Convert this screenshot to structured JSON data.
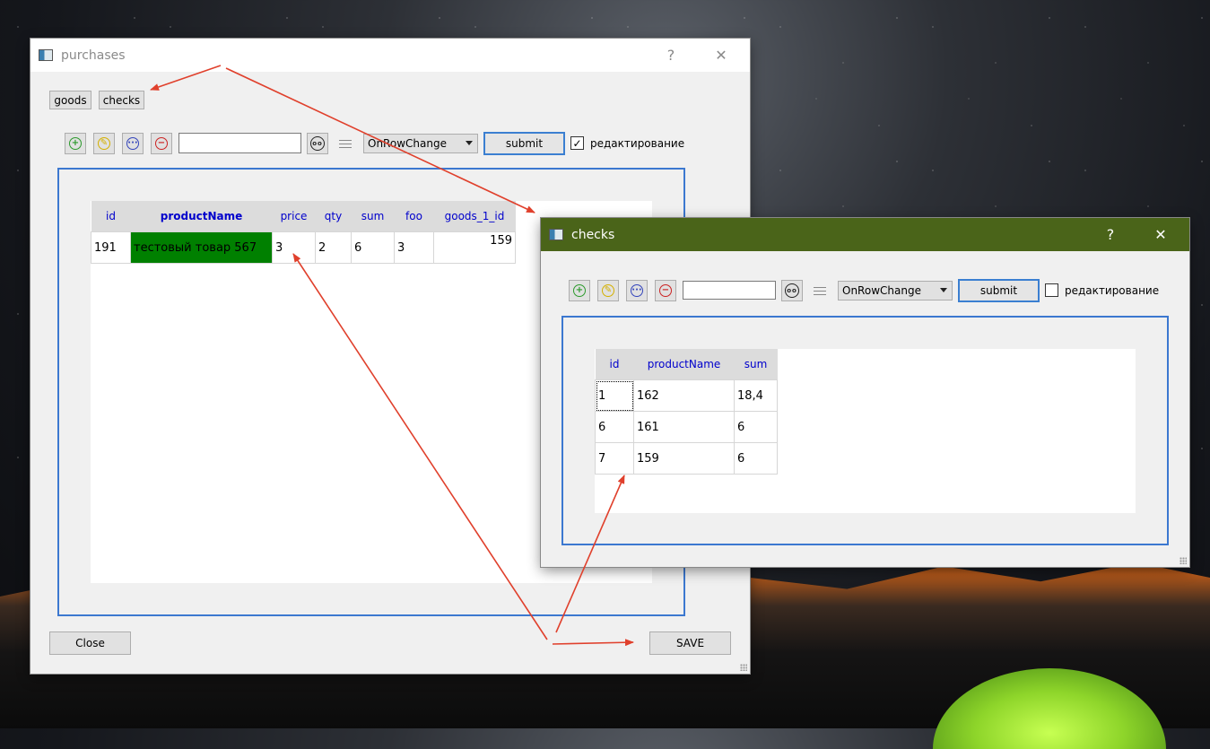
{
  "purchases_window": {
    "title": "purchases",
    "help": "?",
    "close": "✕",
    "tabs": [
      "goods",
      "checks"
    ],
    "toolbar": {
      "search_value": "",
      "mode_select": "OnRowChange",
      "submit_label": "submit",
      "edit_checkbox_label": "редактирование",
      "edit_checked": true
    },
    "table": {
      "headers": [
        "id",
        "productName",
        "price",
        "qty",
        "sum",
        "foo",
        "goods_1_id"
      ],
      "rows": [
        [
          "191",
          "тестовый товар 567",
          "3",
          "2",
          "6",
          "3",
          "159"
        ]
      ],
      "highlight_color": "#008000"
    },
    "close_label": "Close",
    "save_label": "SAVE"
  },
  "checks_window": {
    "title": "checks",
    "help": "?",
    "close": "✕",
    "toolbar": {
      "search_value": "",
      "mode_select": "OnRowChange",
      "submit_label": "submit",
      "edit_checkbox_label": "редактирование",
      "edit_checked": false
    },
    "table": {
      "headers": [
        "id",
        "productName",
        "sum"
      ],
      "rows": [
        [
          "1",
          "162",
          "18,4"
        ],
        [
          "6",
          "161",
          "6"
        ],
        [
          "7",
          "159",
          "6"
        ]
      ]
    }
  },
  "colors": {
    "accent_blue": "#3c78d0",
    "header_text": "#0000cc",
    "checks_titlebar": "#4a6419",
    "annotation_arrow": "#e0402c"
  }
}
